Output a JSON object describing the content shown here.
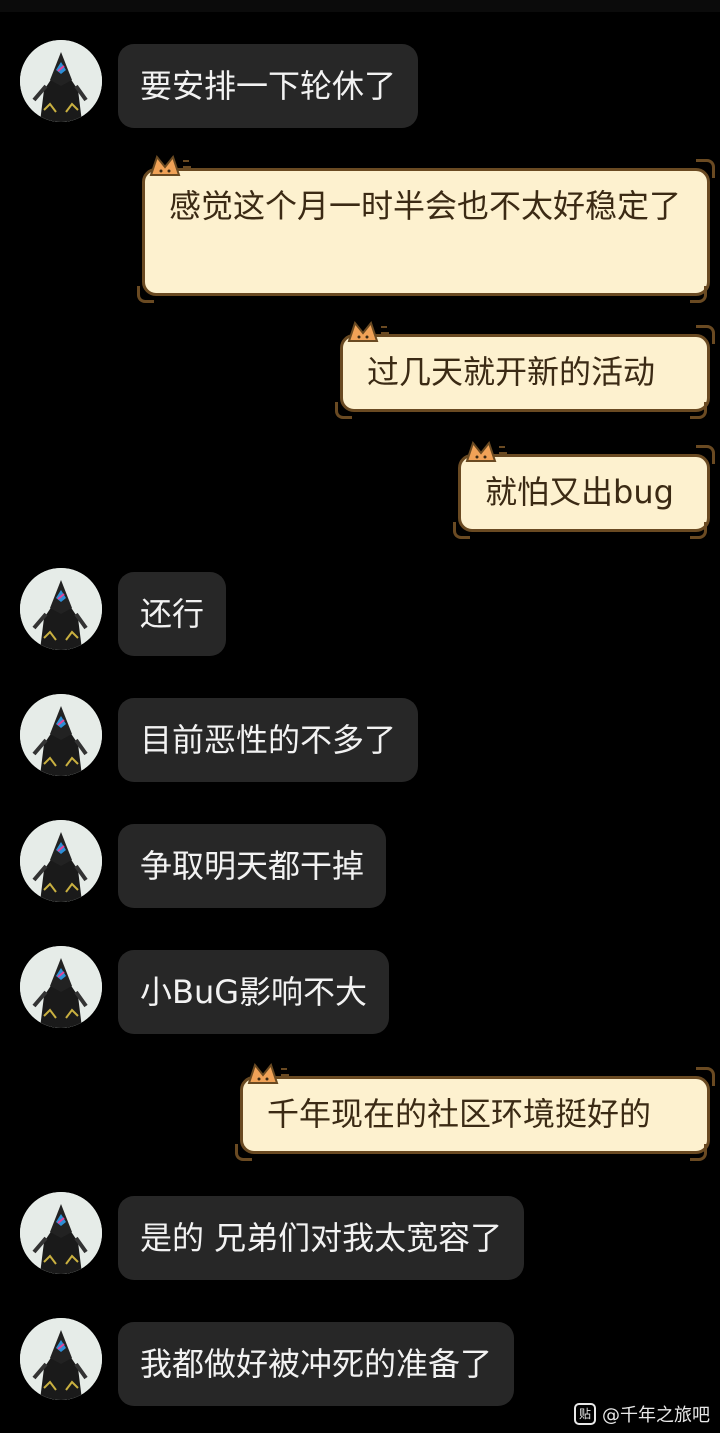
{
  "messages": [
    {
      "side": "left",
      "text": "要安排一下轮休了"
    },
    {
      "side": "right",
      "text": "感觉这个月一时半会也不太好稳定了"
    },
    {
      "side": "right",
      "text": "过几天就开新的活动"
    },
    {
      "side": "right",
      "text": "就怕又出bug"
    },
    {
      "side": "left",
      "text": "还行"
    },
    {
      "side": "left",
      "text": "目前恶性的不多了"
    },
    {
      "side": "left",
      "text": "争取明天都干掉"
    },
    {
      "side": "left",
      "text": "小BuG影响不大"
    },
    {
      "side": "right",
      "text": "千年现在的社区环境挺好的"
    },
    {
      "side": "left",
      "text": "是的 兄弟们对我太宽容了"
    },
    {
      "side": "left",
      "text": "我都做好被冲死的准备了"
    }
  ],
  "watermark": {
    "icon": "tieba-logo-icon",
    "icon_glyph": "贴",
    "text": "@千年之旅吧"
  },
  "colors": {
    "background": "#000000",
    "left_bubble": "#272727",
    "left_text": "#f2f2f2",
    "right_bubble": "#fdf1cf",
    "right_border": "#6a4a22",
    "right_text": "#3b2a14"
  }
}
